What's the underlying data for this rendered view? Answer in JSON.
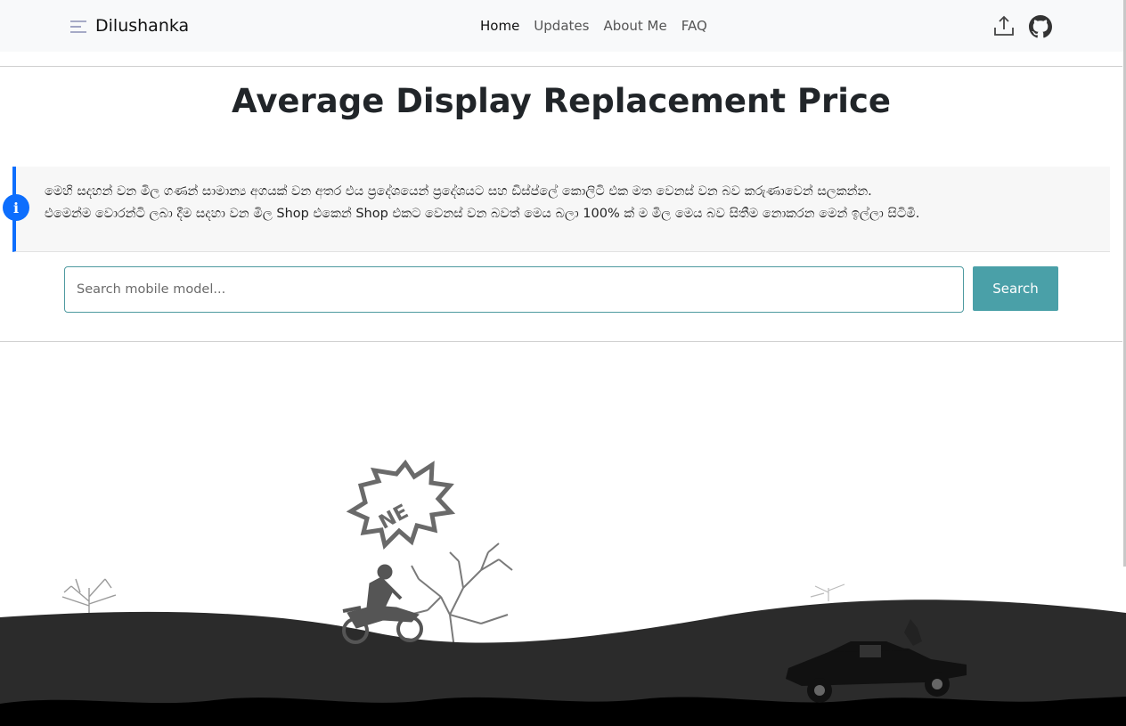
{
  "navbar": {
    "brand": "Dilushanka",
    "links": [
      "Home",
      "Updates",
      "About Me",
      "FAQ"
    ],
    "icons": [
      "menu-icon",
      "upload-icon",
      "github-icon"
    ]
  },
  "page": {
    "title": "Average Display Replacement Price"
  },
  "notice": {
    "icon": "info-icon",
    "line1": "මෙහි සදහන් වන මිල ගණන් සාමාන්‍ය අගයක් වන අතර එය ප්‍රදේශයෙන් ප්‍රදේශයට සහ ඩිස්ප්ලේ කොලිටි එක මත වෙනස් වන බව කරුණාවෙන් සලකන්න.",
    "line2": "එමෙන්ම වොරන්ටි ලබා දීම සදහා වන මිල Shop එකෙන් Shop එකට වෙනස් වන බවත් මෙය බලා 100% ක් ම මිල මෙය බව සිතීම නොකරන මෙන් ඉල්ලා සිටිමි."
  },
  "search": {
    "placeholder": "Search mobile model...",
    "button_label": "Search"
  },
  "scene": {
    "badge_text": "NE"
  },
  "colors": {
    "navbar_bg": "#f8f9fa",
    "accent_blue": "#0d6efd",
    "search_button": "#4aa0a8",
    "ground_dark": "#2b2b2b",
    "ground_black": "#000000"
  }
}
